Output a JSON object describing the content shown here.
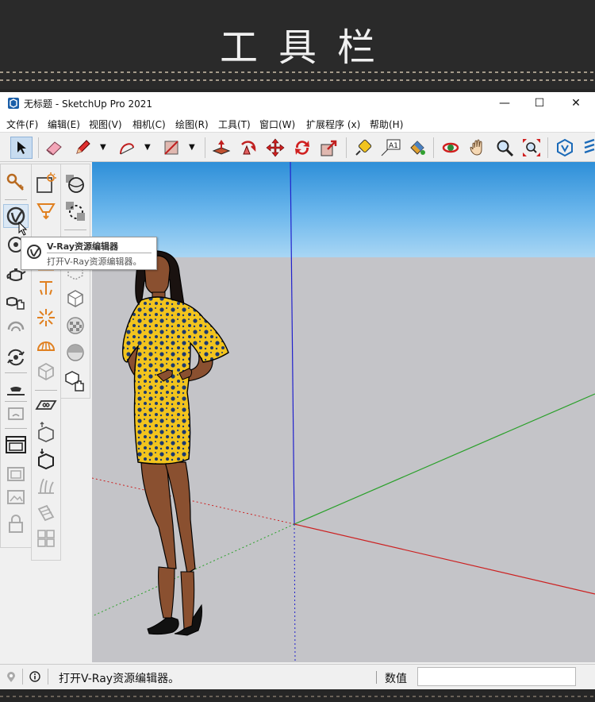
{
  "banner": {
    "title": "工具栏"
  },
  "window": {
    "title": "无标题 - SketchUp Pro 2021",
    "controls": {
      "minimize": "—",
      "maximize": "☐",
      "close": "✕"
    }
  },
  "menu": [
    {
      "label": "文件(F)"
    },
    {
      "label": "编辑(E)"
    },
    {
      "label": "视图(V)"
    },
    {
      "label": "相机(C)"
    },
    {
      "label": "绘图(R)"
    },
    {
      "label": "工具(T)"
    },
    {
      "label": "窗口(W)"
    },
    {
      "label": "扩展程序 (x)"
    },
    {
      "label": "帮助(H)"
    }
  ],
  "toolbar": {
    "tools": [
      "select",
      "eraser",
      "pencil",
      "arc",
      "rectangle",
      "push-pull",
      "follow-me",
      "move",
      "rotate",
      "scale",
      "tape-measure",
      "text",
      "paint-bucket",
      "orbit",
      "pan",
      "zoom",
      "zoom-extents",
      "vray-logo",
      "vray-more"
    ],
    "text_tool_label": "A1"
  },
  "sidebar": {
    "col1": [
      "vray-key",
      "vray-asset-editor",
      "vray-render",
      "teapot",
      "teapot-interactive",
      "render-region",
      "sync",
      "lights-settings",
      "frame-buffer",
      "ipr",
      "viewport",
      "viewport-window",
      "lock"
    ],
    "col2": [
      "lights-panel",
      "spot-light",
      "sphere-light",
      "dome-light",
      "ies-light",
      "omni-light",
      "mesh-light",
      "proxy",
      "infinite-plane",
      "export-proxy",
      "import-proxy",
      "fur",
      "clipper",
      "scatter"
    ],
    "col3": [
      "material-sphere",
      "dotted-selection",
      "cube-outline",
      "cube",
      "checker-sphere",
      "half-sphere",
      "interactive-cube"
    ]
  },
  "tooltip": {
    "title": "V-Ray资源编辑器",
    "description": "打开V-Ray资源编辑器。"
  },
  "status": {
    "message": "打开V-Ray资源编辑器。",
    "value_label": "数值",
    "value": ""
  },
  "colors": {
    "sky_top": "#2e8fd8",
    "ground": "#c4c4c8",
    "axis_red": "#cc2020",
    "axis_green": "#2aa02a",
    "axis_blue": "#2020cc",
    "dress_yellow": "#f2c41e",
    "dress_dots": "#1d3a70",
    "skin": "#8a5030"
  }
}
